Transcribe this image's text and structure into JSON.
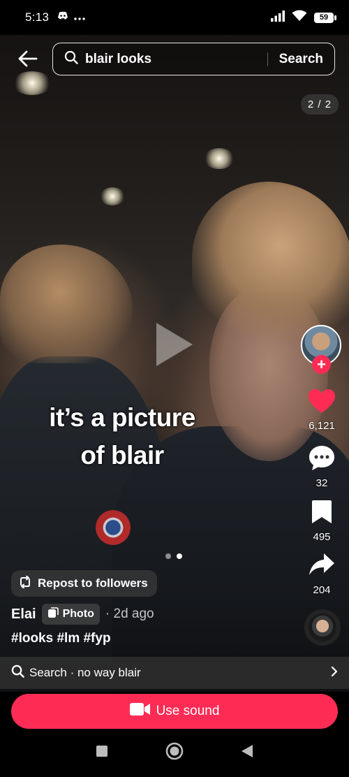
{
  "status_bar": {
    "time": "5:13",
    "battery": "59",
    "icons": [
      "discord-icon",
      "more-dots-icon",
      "signal-icon",
      "wifi-icon",
      "battery-icon"
    ]
  },
  "search": {
    "query": "blair looks",
    "button_label": "Search"
  },
  "page_counter": "2 / 2",
  "caption": {
    "line1": "it’s a picture",
    "line2": "of blair"
  },
  "carousel": {
    "total": 2,
    "current": 2
  },
  "actions": {
    "likes": "6,121",
    "comments": "32",
    "saves": "495",
    "shares": "204",
    "like_color": "#fe2c55"
  },
  "post": {
    "repost_label": "Repost to followers",
    "author": "Elai",
    "type_tag": "Photo",
    "time": "· 2d ago",
    "hashtags": "#looks #lm #fyp"
  },
  "related_search": {
    "text": "Search · no way blair"
  },
  "use_sound": {
    "label": "Use sound",
    "color": "#fe2c55"
  },
  "nav": {
    "icons": [
      "recents-icon",
      "home-icon",
      "back-icon"
    ]
  }
}
